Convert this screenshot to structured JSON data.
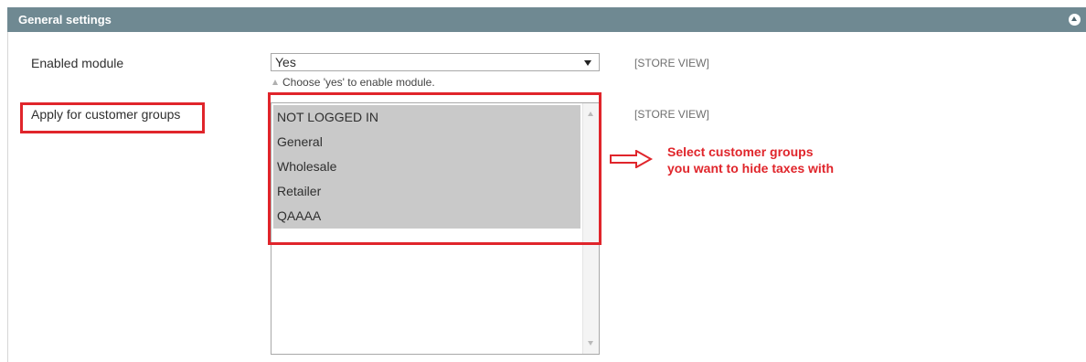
{
  "section": {
    "title": "General settings",
    "collapse_icon": "chevron-up-circle-icon"
  },
  "fields": {
    "enabled_module": {
      "label": "Enabled module",
      "value": "Yes",
      "hint": "Choose 'yes' to enable module.",
      "scope": "[STORE VIEW]"
    },
    "customer_groups": {
      "label": "Apply for customer groups",
      "scope": "[STORE VIEW]",
      "options": [
        "NOT LOGGED IN",
        "General",
        "Wholesale",
        "Retailer",
        "QAAAA"
      ],
      "selected": [
        "NOT LOGGED IN",
        "General",
        "Wholesale",
        "Retailer",
        "QAAAA"
      ]
    }
  },
  "annotation": {
    "line1": "Select customer groups",
    "line2": "you want to hide taxes with",
    "color": "#e0252b"
  },
  "colors": {
    "header_bg": "#6f8992",
    "selected_option_bg": "#c9c9c9"
  }
}
